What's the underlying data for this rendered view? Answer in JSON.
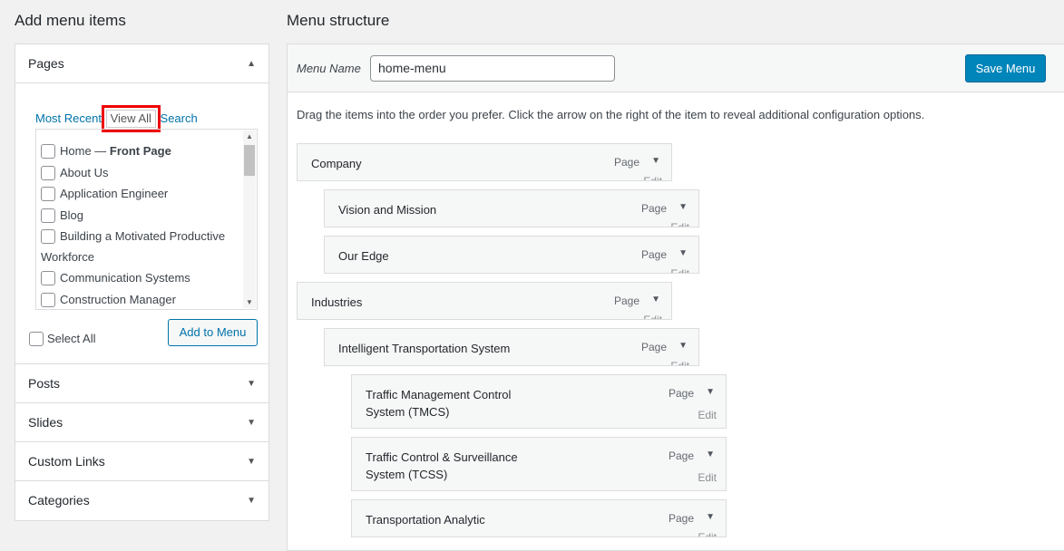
{
  "left": {
    "title": "Add menu items",
    "sections": [
      {
        "label": "Pages",
        "arrow": "▲"
      },
      {
        "label": "Posts",
        "arrow": "▼"
      },
      {
        "label": "Slides",
        "arrow": "▼"
      },
      {
        "label": "Custom Links",
        "arrow": "▼"
      },
      {
        "label": "Categories",
        "arrow": "▼"
      }
    ],
    "tabs": {
      "most_recent": "Most Recent",
      "view_all": "View All",
      "search": "Search"
    },
    "pages": [
      {
        "label": "Home",
        "suffix": " — ",
        "bold": "Front Page"
      },
      {
        "label": "About Us"
      },
      {
        "label": "Application Engineer"
      },
      {
        "label": "Blog"
      },
      {
        "label": "Building a Motivated Productive Workforce"
      },
      {
        "label": "Communication Systems"
      },
      {
        "label": "Construction Manager"
      }
    ],
    "select_all": "Select All",
    "add_to_menu": "Add to Menu"
  },
  "right": {
    "title": "Menu structure",
    "menu_name_label": "Menu Name",
    "menu_name_value": "home-menu",
    "save_label": "Save Menu",
    "instructions": "Drag the items into the order you prefer. Click the arrow on the right of the item to reveal additional configuration options.",
    "item_type": "Page",
    "edit_label": "Edit",
    "items": [
      {
        "title": "Company",
        "depth": 0
      },
      {
        "title": "Vision and Mission",
        "depth": 1
      },
      {
        "title": "Our Edge",
        "depth": 1
      },
      {
        "title": "Industries",
        "depth": 0
      },
      {
        "title": "Intelligent Transportation System",
        "depth": 1
      },
      {
        "title": "Traffic Management Control System (TMCS)",
        "depth": 2
      },
      {
        "title": "Traffic Control & Surveillance System (TCSS)",
        "depth": 2
      },
      {
        "title": "Transportation Analytic",
        "depth": 2
      }
    ]
  },
  "colors": {
    "accent": "#0073aa",
    "primary_button": "#0085ba",
    "highlight": "#e00000"
  },
  "icons": {
    "expand": "triangle-down-icon",
    "collapse": "triangle-up-icon"
  }
}
